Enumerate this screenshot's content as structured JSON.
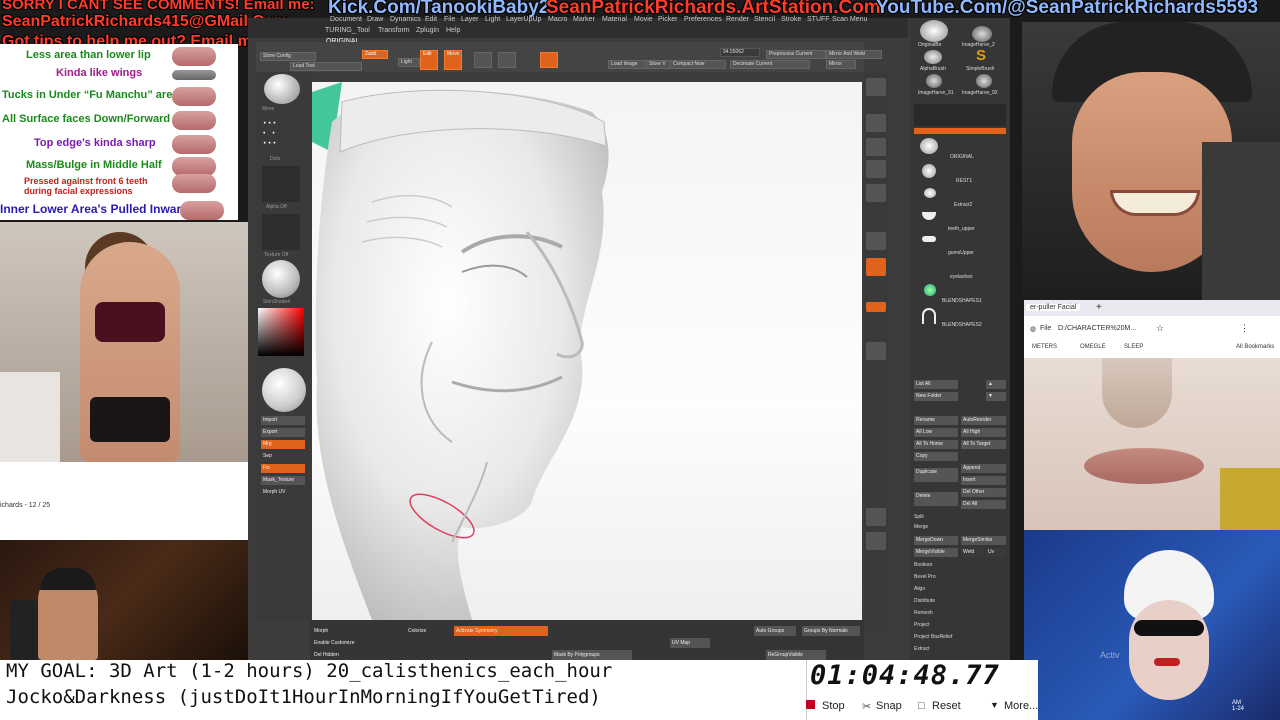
{
  "banner": {
    "line1": "SORRY I CANT SEE COMMENTS! Email me:",
    "email": "SeanPatrickRichards415@GMail.Com",
    "tips": "Got tips to help me out? Email me!",
    "kick": "Kick.Com/TanookiBaby2",
    "artstation": "SeanPatrickRichards.ArtStation.Com",
    "youtube": "YouTube.Com/@SeanPatrickRichards5593"
  },
  "lip_notes": [
    {
      "text": "Less area than lower lip",
      "color": "#1a8a1a"
    },
    {
      "text": "Kinda like wings",
      "color": "#a01a8a"
    },
    {
      "text": "Tucks in Under “Fu Manchu” area",
      "color": "#1a8a1a"
    },
    {
      "text": "All Surface faces Down/Forward",
      "color": "#1a8a1a"
    },
    {
      "text": "Top edge's kinda sharp",
      "color": "#7a1ab0"
    },
    {
      "text": "Mass/Bulge in Middle Half",
      "color": "#1a8a1a"
    },
    {
      "text": "Pressed against front 6 teeth",
      "color": "#c0201a"
    },
    {
      "text": "during facial expressions",
      "color": "#c0201a"
    },
    {
      "text": "Inner Lower Area's Pulled Inward",
      "color": "#2a1ab0"
    }
  ],
  "pdf_page": "ichards - 12 / 25",
  "zbrush": {
    "menu": [
      "Document",
      "Draw",
      "Dynamics",
      "Edit",
      "File",
      "Layer",
      "Light",
      "LayerUpUp",
      "Macro",
      "Marker",
      "Material",
      "Movie",
      "Picker",
      "Preferences",
      "Render",
      "Stencil",
      "Stroke",
      "STUFF",
      "Scan Menu"
    ],
    "menu2": [
      "TURING_",
      "Tool",
      "Transform",
      "Zplugin",
      "Help"
    ],
    "doc_label": "ORIGINAL",
    "focal_value": "94.55062",
    "toolbar_labels": [
      "Store Config",
      "Zadd",
      "Load Tool",
      "Light",
      "Light Stroke",
      "Edit",
      "Move",
      "Preprocess Current",
      "Mirror And Weld",
      "Store V",
      "Load Image",
      "Compact Now",
      "Decimate Current",
      "Mirror"
    ],
    "left_labels": [
      "Move",
      "Dots",
      "Alpha Off",
      "Texture Off",
      "SkinShade4",
      "Import",
      "Export",
      "Mrg",
      "Sep",
      "Fxr",
      "Mask_Texture",
      "Morph UV"
    ],
    "tray_labels": [
      "OriginalBo",
      "ImageHarve_2",
      "AlphaBrush",
      "SimpleBrush",
      "ImageHarve_91",
      "ImageHarve_92"
    ],
    "subtools": [
      "ORIGINAL",
      "REST1",
      "Extract2",
      "teeth_upper",
      "gumsUpper",
      "eyelashes",
      "BLENDSHAPES1",
      "BLENDSHAPES2"
    ],
    "subtool_buttons": [
      "List All",
      "New Folder",
      "Rename",
      "AutoReorder",
      "All Low",
      "All High",
      "All To Home",
      "All To Target",
      "Copy",
      "Paste",
      "Duplicate",
      "Append",
      "Insert",
      "Delete",
      "Del Other",
      "Del All",
      "Split",
      "Merge",
      "MergeDown",
      "MergeSimilar",
      "MergeVisible",
      "Weld",
      "Uv",
      "Boolean",
      "Bevel Pro",
      "Align",
      "Distribute",
      "Remesh",
      "Project",
      "Project BasRelief",
      "Extract"
    ],
    "bottom_labels": [
      "Morph",
      "Enable Customize",
      "Colorize",
      "Activate Symmetry",
      "Auto Groups",
      "Groups By Normals",
      "Mask By Polygroups",
      "UV Map",
      "ReGroupVisible",
      "Del Hidden"
    ]
  },
  "browser": {
    "tab": "er-puller Facial",
    "address": "D:/CHARACTER%20M...",
    "bookmarks": [
      "METERS",
      "OMEGLE",
      "SLEEP",
      "All Bookmarks"
    ],
    "file_label": "File"
  },
  "goal": {
    "line1": "MY GOAL: 3D Art (1-2 hours) 20_calisthenics_each_hour",
    "line2": "Jocko&Darkness (justDoIt1HourInMorningIfYouGetTired)"
  },
  "timer": {
    "value": "01:04:48.77",
    "stop": "Stop",
    "snap": "Snap",
    "reset": "Reset",
    "more": "More..."
  },
  "clock": {
    "time": "AM",
    "date": "1-24"
  },
  "activate_windows": "Activ"
}
